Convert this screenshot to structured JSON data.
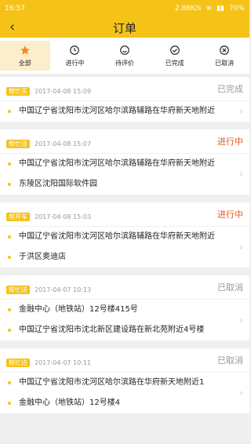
{
  "status_bar": {
    "time": "16:57",
    "speed": "2.88K/s",
    "battery": "70%"
  },
  "header": {
    "title": "订单"
  },
  "tabs": [
    {
      "label": "全部",
      "icon": "star-icon"
    },
    {
      "label": "进行中",
      "icon": "clock-icon"
    },
    {
      "label": "待评价",
      "icon": "smile-icon"
    },
    {
      "label": "已完成",
      "icon": "check-icon"
    },
    {
      "label": "已取消",
      "icon": "cancel-icon"
    }
  ],
  "orders": [
    {
      "type": "帮忙买",
      "date": "2017-04-08 15:09",
      "status": "已完成",
      "status_color": "#999999",
      "addresses": [
        "中国辽宁省沈阳市沈河区哈尔滨路辅路在华府新天地附近"
      ]
    },
    {
      "type": "帮忙送",
      "date": "2017-04-08 15:07",
      "status": "进行中",
      "status_color": "#e85a1c",
      "addresses": [
        "中国辽宁省沈阳市沈河区哈尔滨路辅路在华府新天地附近",
        "东陵区沈阳国际软件园"
      ]
    },
    {
      "type": "帮开车",
      "date": "2017-04-08 15:03",
      "status": "进行中",
      "status_color": "#e85a1c",
      "addresses": [
        "中国辽宁省沈阳市沈河区哈尔滨路辅路在华府新天地附近",
        "于洪区奥迪店"
      ]
    },
    {
      "type": "帮忙送",
      "date": "2017-04-07 10:13",
      "status": "已取消",
      "status_color": "#999999",
      "addresses": [
        "金融中心（地铁站）12号楼415号",
        "中国辽宁省沈阳市沈北新区建设路在新北苑附近4号楼"
      ]
    },
    {
      "type": "帮忙送",
      "date": "2017-04-07 10:11",
      "status": "已取消",
      "status_color": "#999999",
      "addresses": [
        "中国辽宁省沈阳市沈河区哈尔滨路在华府新天地附近1",
        "金融中心（地铁站）12号楼4"
      ]
    }
  ]
}
